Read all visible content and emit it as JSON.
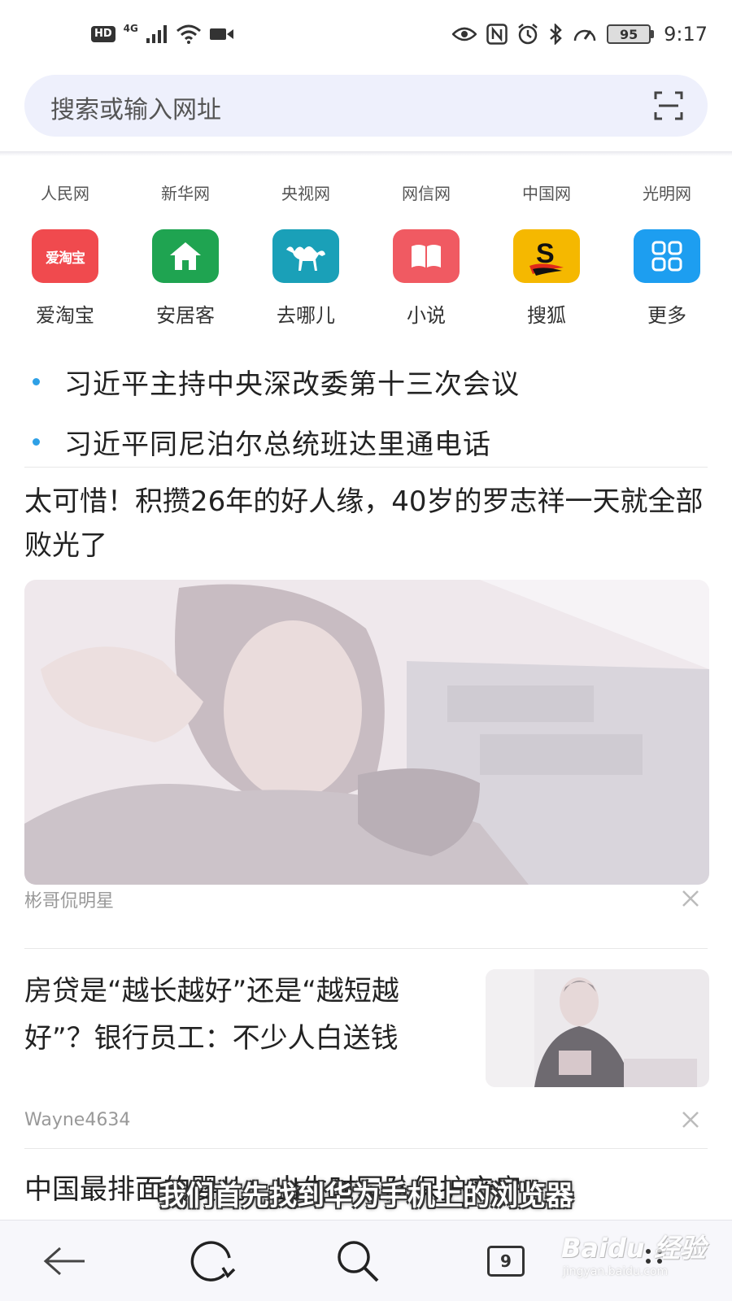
{
  "status_bar": {
    "hd": "HD",
    "network": "4G",
    "battery": "95",
    "time": "9:17"
  },
  "search": {
    "placeholder": "搜索或输入网址",
    "scan_icon": "scan-icon"
  },
  "quick_links": [
    "人民网",
    "新华网",
    "央视网",
    "网信网",
    "中国网",
    "光明网"
  ],
  "apps": [
    {
      "label": "爱淘宝",
      "icon": "aitaobao-icon",
      "icon_text": "爱淘宝",
      "color": "#f04a4e"
    },
    {
      "label": "安居客",
      "icon": "house-icon",
      "color": "#1fa451"
    },
    {
      "label": "去哪儿",
      "icon": "camel-icon",
      "color": "#1aa0b8"
    },
    {
      "label": "小说",
      "icon": "book-icon",
      "color": "#f05a62"
    },
    {
      "label": "搜狐",
      "icon": "sohu-icon",
      "color": "#f5b800"
    },
    {
      "label": "更多",
      "icon": "grid-icon",
      "color": "#1d9ef0"
    }
  ],
  "hot_news": [
    "习近平主持中央深改委第十三次会议",
    "习近平同尼泊尔总统班达里通电话"
  ],
  "articles": [
    {
      "title": "太可惜！积攒26年的好人缘，40岁的罗志祥一天就全部败光了",
      "source": "彬哥侃明星"
    },
    {
      "title": "房贷是“越长越好”还是“越短越好”？银行员工：不少人白送钱",
      "source": "Wayne4634"
    },
    {
      "title": "中国最排面的婴儿：出生时军队保护产房，"
    }
  ],
  "subtitle": "我们首先找到华为手机上的浏览器",
  "bottom_nav": {
    "tab_count": "9"
  },
  "watermark": {
    "main": "Baidu 经验",
    "sub": "jingyan.baidu.com"
  }
}
